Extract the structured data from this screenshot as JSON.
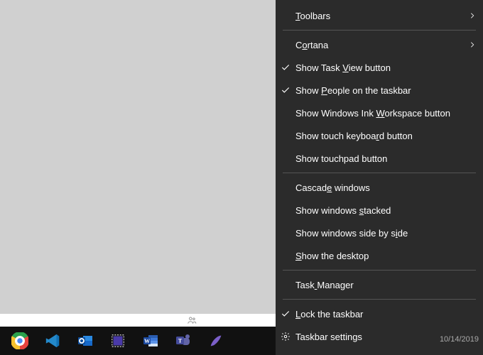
{
  "context_menu": {
    "items": [
      {
        "label": "Toolbars",
        "hotkey_index": 0,
        "has_submenu": true
      },
      {
        "separator": true
      },
      {
        "label": "Cortana",
        "hotkey_index": 1,
        "has_submenu": true
      },
      {
        "label": "Show Task View button",
        "hotkey_index": 10,
        "checked": true
      },
      {
        "label": "Show People on the taskbar",
        "hotkey_index": 5,
        "checked": true
      },
      {
        "label": "Show Windows Ink Workspace button",
        "hotkey_index": 17
      },
      {
        "label": "Show touch keyboard button",
        "hotkey_index": 17
      },
      {
        "label": "Show touchpad button"
      },
      {
        "separator": true
      },
      {
        "label": "Cascade windows",
        "hotkey_index": 6
      },
      {
        "label": "Show windows stacked",
        "hotkey_index": 13
      },
      {
        "label": "Show windows side by side",
        "hotkey_index": 22
      },
      {
        "label": "Show the desktop",
        "hotkey_index": 0
      },
      {
        "separator": true
      },
      {
        "label": "Task Manager",
        "hotkey_index": 4
      },
      {
        "separator": true
      },
      {
        "label": "Lock the taskbar",
        "hotkey_index": 0,
        "checked": true
      },
      {
        "label": "Taskbar settings",
        "icon": "gear"
      }
    ]
  },
  "taskbar": {
    "icons": [
      {
        "name": "chrome"
      },
      {
        "name": "vscode"
      },
      {
        "name": "outlook"
      },
      {
        "name": "snip"
      },
      {
        "name": "word"
      },
      {
        "name": "teams"
      },
      {
        "name": "pen"
      }
    ]
  },
  "system": {
    "date": "10/14/2019"
  }
}
